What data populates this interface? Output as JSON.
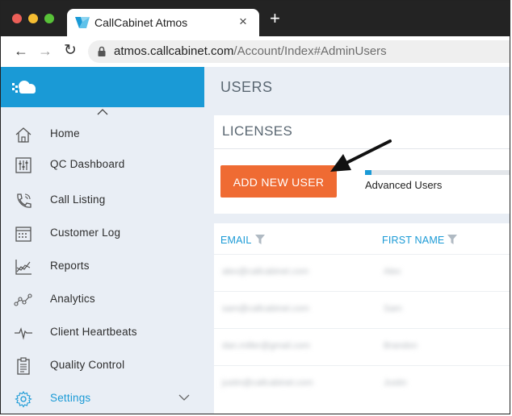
{
  "browser": {
    "tab_title": "CallCabinet Atmos",
    "tab_close": "×",
    "new_tab": "+",
    "url_host": "atmos.callcabinet.com",
    "url_path": "/Account/Index#AdminUsers"
  },
  "sidebar": {
    "items": [
      {
        "label": "Home",
        "icon": "home-icon"
      },
      {
        "label": "QC Dashboard",
        "icon": "sliders-icon"
      },
      {
        "label": "Call Listing",
        "icon": "phone-icon"
      },
      {
        "label": "Customer Log",
        "icon": "calendar-icon"
      },
      {
        "label": "Reports",
        "icon": "chart-icon"
      },
      {
        "label": "Analytics",
        "icon": "analytics-icon"
      },
      {
        "label": "Client Heartbeats",
        "icon": "heartbeat-icon"
      },
      {
        "label": "Quality Control",
        "icon": "clipboard-icon"
      },
      {
        "label": "Settings",
        "icon": "gear-icon",
        "active": true
      }
    ]
  },
  "main": {
    "page_title": "USERS",
    "licenses": {
      "title": "LICENSES",
      "add_button": "ADD NEW USER",
      "advanced_users_label": "Advanced Users",
      "advanced_users_fraction": 0.04
    },
    "table": {
      "columns": [
        "EMAIL",
        "FIRST NAME"
      ],
      "rows": [
        [
          "alex@callcabinet.com",
          "Alex"
        ],
        [
          "sam@callcabinet.com",
          "Sam"
        ],
        [
          "dan.miller@gmail.com",
          "Brandon"
        ],
        [
          "justin@callcabinet.com",
          "Justin"
        ]
      ]
    }
  },
  "colors": {
    "accent": "#1a9ad6",
    "button": "#ef6b33",
    "sidebar_bg": "#e9eef5"
  }
}
